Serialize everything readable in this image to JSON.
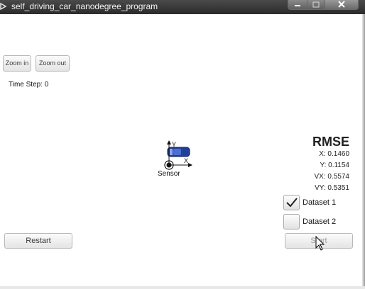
{
  "window": {
    "title": "self_driving_car_nanodegree_program"
  },
  "toolbar": {
    "zoom_in_label": "Zoom in",
    "zoom_out_label": "Zoom out"
  },
  "status": {
    "time_step": "Time Step: 0"
  },
  "rmse": {
    "title": "RMSE",
    "x": "X: 0.1460",
    "y": "Y: 0.1154",
    "vx": "VX: 0.5574",
    "vy": "VY: 0.5351"
  },
  "datasets": [
    {
      "label": "Dataset 1",
      "checked": true
    },
    {
      "label": "Dataset 2",
      "checked": false
    }
  ],
  "scene": {
    "sensor_label": "Sensor",
    "axis_x": "X",
    "axis_y": "Y"
  },
  "controls": {
    "restart_label": "Restart",
    "start_label": "Start"
  },
  "colors": {
    "car": "#1f3f9a",
    "titlebar": "#2b2b2b"
  }
}
